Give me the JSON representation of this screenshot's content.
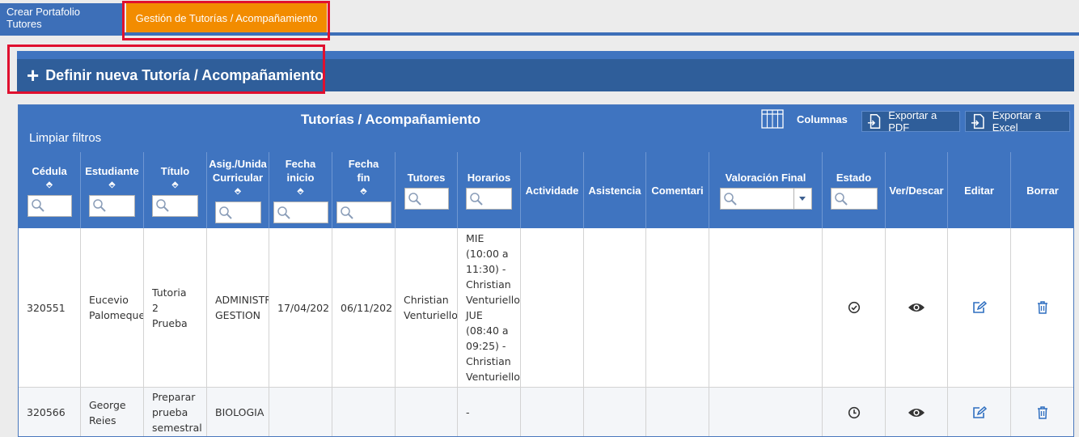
{
  "tabs": [
    {
      "label": "Crear Portafolio Tutores",
      "active": false
    },
    {
      "label": "Gestión de Tutorías / Acompañamiento",
      "active": true
    }
  ],
  "new_button": {
    "plus": "+",
    "label": "Definir nueva Tutoría / Acompañamiento"
  },
  "panel": {
    "title": "Tutorías / Acompañamiento",
    "clear_filters": "Limpiar filtros",
    "columns_label": "Columnas",
    "export_pdf": "Exportar a PDF",
    "export_excel": "Exportar a Excel"
  },
  "columns": [
    {
      "key": "cedula",
      "lines": [
        "Cédula"
      ],
      "sort": true,
      "filter": "search"
    },
    {
      "key": "estudiante",
      "lines": [
        "Estudiante"
      ],
      "sort": true,
      "filter": "search"
    },
    {
      "key": "titulo",
      "lines": [
        "Título"
      ],
      "sort": true,
      "filter": "search"
    },
    {
      "key": "asig",
      "lines": [
        "Asig./Unida",
        "Curricular"
      ],
      "sort": true,
      "filter": "search"
    },
    {
      "key": "fecha_inicio",
      "lines": [
        "Fecha",
        "inicio"
      ],
      "sort": true,
      "filter": "search"
    },
    {
      "key": "fecha_fin",
      "lines": [
        "Fecha",
        "fin"
      ],
      "sort": true,
      "filter": "search"
    },
    {
      "key": "tutores",
      "lines": [
        "Tutores"
      ],
      "sort": false,
      "filter": "search"
    },
    {
      "key": "horarios",
      "lines": [
        "Horarios"
      ],
      "sort": false,
      "filter": "search"
    },
    {
      "key": "actividades",
      "lines": [
        "Actividade"
      ],
      "sort": false,
      "filter": "none"
    },
    {
      "key": "asistencia",
      "lines": [
        "Asistencia"
      ],
      "sort": false,
      "filter": "none"
    },
    {
      "key": "comentarios",
      "lines": [
        "Comentari"
      ],
      "sort": false,
      "filter": "none"
    },
    {
      "key": "valoracion",
      "lines": [
        "Valoración Final"
      ],
      "sort": false,
      "filter": "dropdown"
    },
    {
      "key": "estado",
      "lines": [
        "Estado"
      ],
      "sort": false,
      "filter": "search"
    },
    {
      "key": "ver",
      "lines": [
        "Ver/Descar"
      ],
      "sort": false,
      "filter": "none"
    },
    {
      "key": "editar",
      "lines": [
        "Editar"
      ],
      "sort": false,
      "filter": "none"
    },
    {
      "key": "borrar",
      "lines": [
        "Borrar"
      ],
      "sort": false,
      "filter": "none"
    }
  ],
  "sort_glyph": "⬘",
  "rows": [
    {
      "cedula": "320551",
      "estudiante": [
        "Eucevio",
        "Palomeque"
      ],
      "titulo": [
        "Tutoria",
        "2",
        "Prueba"
      ],
      "asig": [
        "ADMINISTR",
        "GESTION"
      ],
      "fecha_inicio": "17/04/202",
      "fecha_fin": "06/11/202",
      "tutores": [
        "Christian",
        "Venturiello"
      ],
      "horarios": [
        "MIE",
        "(10:00 a",
        "11:30) -",
        "Christian",
        "Venturiello",
        "JUE",
        "(08:40 a",
        "09:25) -",
        "Christian",
        "Venturiello"
      ],
      "actividades": "",
      "asistencia": "",
      "comentarios": "",
      "valoracion": "",
      "estado_icon": "check-circle-icon"
    },
    {
      "cedula": "320566",
      "estudiante": [
        "George",
        "Reies"
      ],
      "titulo": [
        "Preparar",
        "prueba",
        "semestral"
      ],
      "asig": [
        "BIOLOGIA"
      ],
      "fecha_inicio": "",
      "fecha_fin": "",
      "tutores": [
        ""
      ],
      "horarios": [
        "-"
      ],
      "actividades": "",
      "asistencia": "",
      "comentarios": "",
      "valoracion": "",
      "estado_icon": "clock-icon"
    }
  ],
  "colors": {
    "tab_active": "#f28c00",
    "header_blue": "#3f74c0",
    "dark_blue": "#2f5e9a",
    "highlight_red": "#e0102f"
  }
}
